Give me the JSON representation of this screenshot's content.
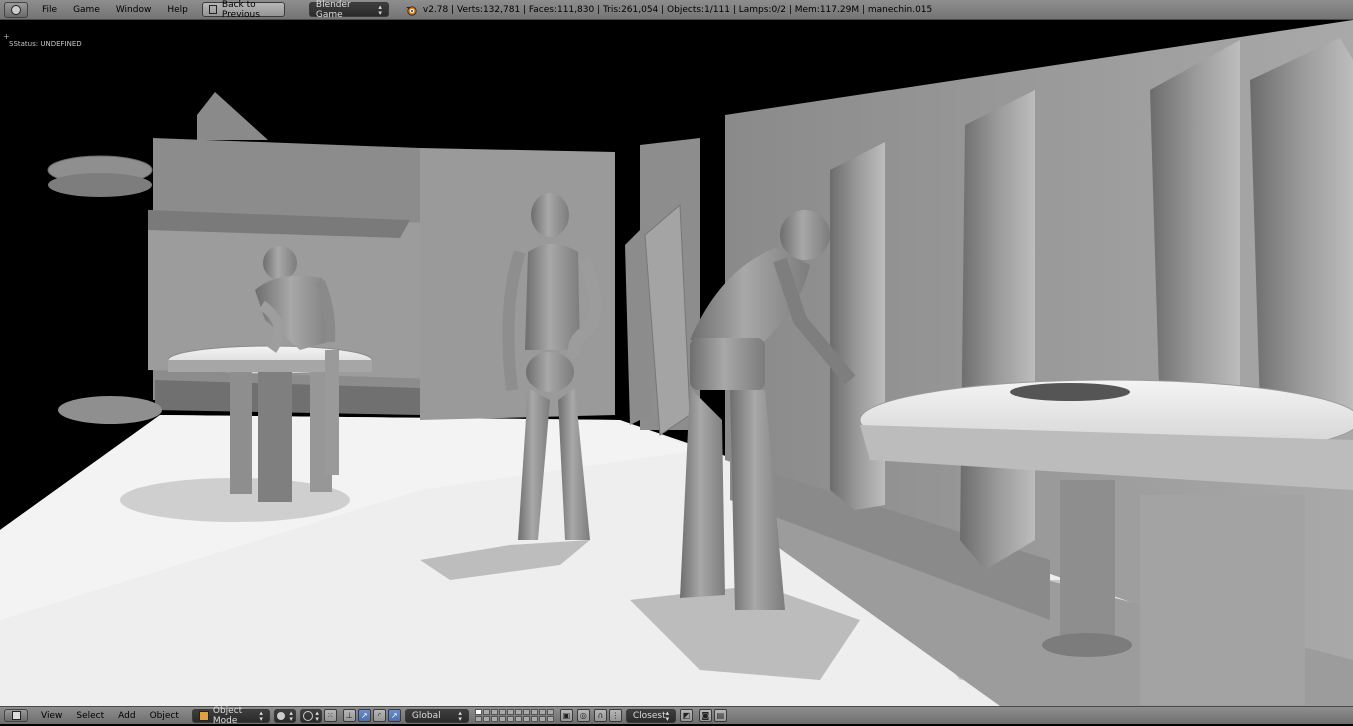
{
  "header": {
    "menus": [
      "File",
      "Game",
      "Window",
      "Help"
    ],
    "back_button": "Back to Previous",
    "engine": "Blender Game",
    "stats": "v2.78 | Verts:132,781 | Faces:111,830 | Tris:261,054 | Objects:1/111 | Lamps:0/2 | Mem:117.29M | manechin.015"
  },
  "viewport": {
    "status": "SStatus: UNDEFINED",
    "corner": "+"
  },
  "footer": {
    "menus": [
      "View",
      "Select",
      "Add",
      "Object"
    ],
    "mode": "Object Mode",
    "orientation": "Global",
    "snap_target": "Closest"
  },
  "colors": {
    "header_bg": "#7f7f7f",
    "dropdown_bg": "#333333",
    "active_button": "#5a7cbc",
    "viewport_bg": "#000000",
    "floor": "#efefef"
  }
}
